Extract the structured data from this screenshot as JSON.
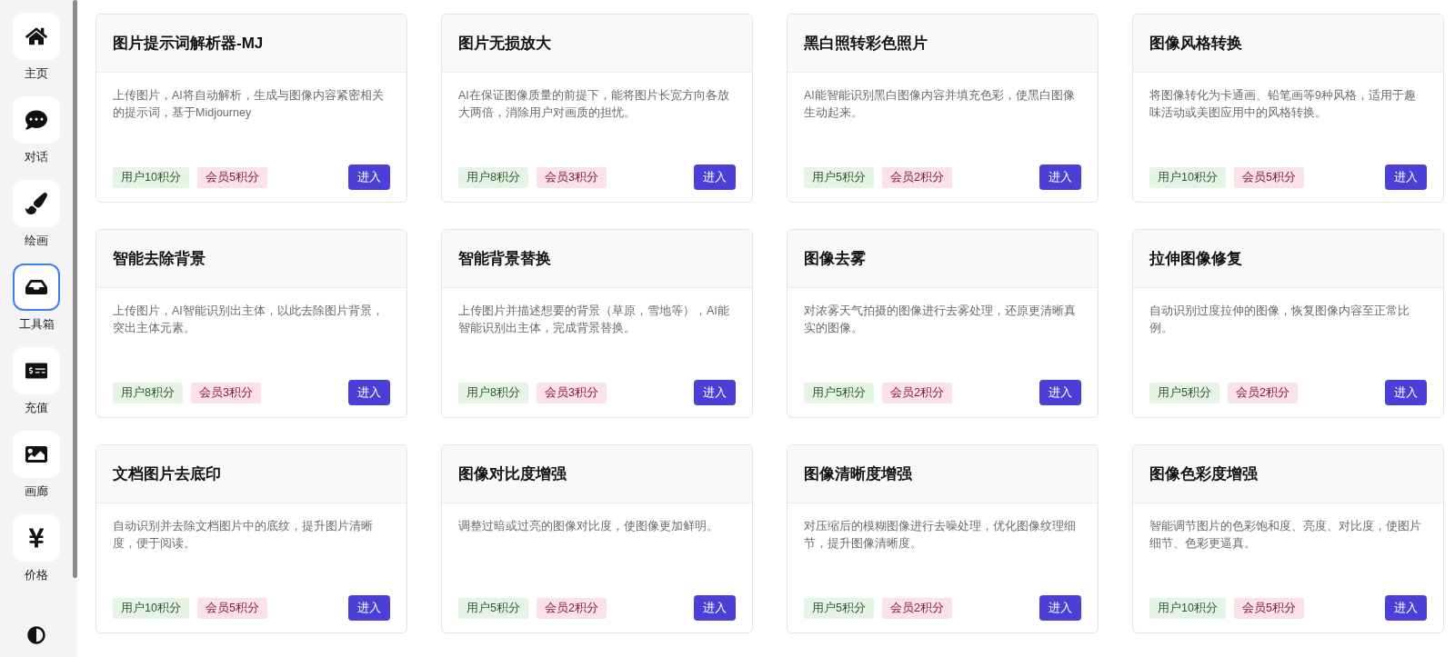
{
  "sidebar": {
    "items": [
      {
        "label": "主页",
        "selected": false
      },
      {
        "label": "对话",
        "selected": false
      },
      {
        "label": "绘画",
        "selected": false
      },
      {
        "label": "工具箱",
        "selected": true
      },
      {
        "label": "充值",
        "selected": false
      },
      {
        "label": "画廊",
        "selected": false
      },
      {
        "label": "价格",
        "selected": false
      }
    ]
  },
  "tools": [
    {
      "title": "图片提示词解析器-MJ",
      "description": "上传图片，AI将自动解析，生成与图像内容紧密相关的提示词，基于Midjourney",
      "user_cost": "用户10积分",
      "member_cost": "会员5积分",
      "button": "进入"
    },
    {
      "title": "图片无损放大",
      "description": "AI在保证图像质量的前提下，能将图片长宽方向各放大两倍，消除用户对画质的担忧。",
      "user_cost": "用户8积分",
      "member_cost": "会员3积分",
      "button": "进入"
    },
    {
      "title": "黑白照转彩色照片",
      "description": "AI能智能识别黑白图像内容并填充色彩，使黑白图像生动起来。",
      "user_cost": "用户5积分",
      "member_cost": "会员2积分",
      "button": "进入"
    },
    {
      "title": "图像风格转换",
      "description": "将图像转化为卡通画、铅笔画等9种风格，适用于趣味活动或美图应用中的风格转换。",
      "user_cost": "用户10积分",
      "member_cost": "会员5积分",
      "button": "进入"
    },
    {
      "title": "智能去除背景",
      "description": "上传图片，AI智能识别出主体，以此去除图片背景，突出主体元素。",
      "user_cost": "用户8积分",
      "member_cost": "会员3积分",
      "button": "进入"
    },
    {
      "title": "智能背景替换",
      "description": "上传图片并描述想要的背景（草原，雪地等），AI能智能识别出主体，完成背景替换。",
      "user_cost": "用户8积分",
      "member_cost": "会员3积分",
      "button": "进入"
    },
    {
      "title": "图像去雾",
      "description": "对浓雾天气拍摄的图像进行去雾处理，还原更清晰真实的图像。",
      "user_cost": "用户5积分",
      "member_cost": "会员2积分",
      "button": "进入"
    },
    {
      "title": "拉伸图像修复",
      "description": "自动识别过度拉伸的图像，恢复图像内容至正常比例。",
      "user_cost": "用户5积分",
      "member_cost": "会员2积分",
      "button": "进入"
    },
    {
      "title": "文档图片去底印",
      "description": "自动识别并去除文档图片中的底纹，提升图片清晰度，便于阅读。",
      "user_cost": "用户10积分",
      "member_cost": "会员5积分",
      "button": "进入"
    },
    {
      "title": "图像对比度增强",
      "description": "调整过暗或过亮的图像对比度，使图像更加鲜明。",
      "user_cost": "用户5积分",
      "member_cost": "会员2积分",
      "button": "进入"
    },
    {
      "title": "图像清晰度增强",
      "description": "对压缩后的模糊图像进行去噪处理，优化图像纹理细节，提升图像清晰度。",
      "user_cost": "用户5积分",
      "member_cost": "会员2积分",
      "button": "进入"
    },
    {
      "title": "图像色彩度增强",
      "description": "智能调节图片的色彩饱和度、亮度、对比度，使图片细节、色彩更逼真。",
      "user_cost": "用户10积分",
      "member_cost": "会员5积分",
      "button": "进入"
    }
  ]
}
